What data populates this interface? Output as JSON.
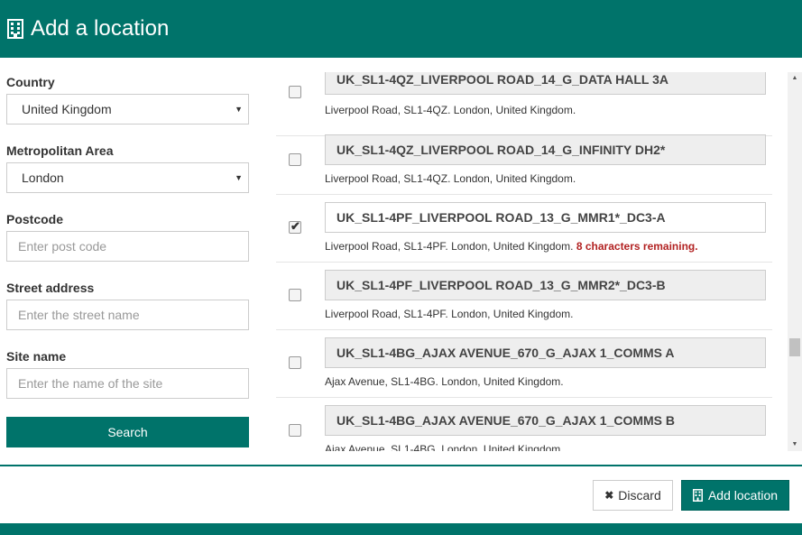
{
  "dialog": {
    "title": "Add a location",
    "title_icon": "building-icon"
  },
  "filters": {
    "country_label": "Country",
    "country_value": "United Kingdom",
    "metro_label": "Metropolitan Area",
    "metro_value": "London",
    "postcode_label": "Postcode",
    "postcode_placeholder": "Enter post code",
    "street_label": "Street address",
    "street_placeholder": "Enter the street name",
    "site_label": "Site name",
    "site_placeholder": "Enter the name of the site",
    "search_label": "Search"
  },
  "locations": [
    {
      "name": "UK_SL1-4QZ_LIVERPOOL ROAD_14_G_DATA HALL 3A",
      "address": "Liverpool Road, SL1-4QZ. London, United Kingdom.",
      "checked": false,
      "warning": ""
    },
    {
      "name": "UK_SL1-4QZ_LIVERPOOL ROAD_14_G_INFINITY DH2*",
      "address": "Liverpool Road, SL1-4QZ. London, United Kingdom.",
      "checked": false,
      "warning": ""
    },
    {
      "name": "UK_SL1-4PF_LIVERPOOL ROAD_13_G_MMR1*_DC3-A",
      "address": "Liverpool Road, SL1-4PF. London, United Kingdom.",
      "checked": true,
      "warning": "8 characters remaining."
    },
    {
      "name": "UK_SL1-4PF_LIVERPOOL ROAD_13_G_MMR2*_DC3-B",
      "address": "Liverpool Road, SL1-4PF. London, United Kingdom.",
      "checked": false,
      "warning": ""
    },
    {
      "name": "UK_SL1-4BG_AJAX AVENUE_670_G_AJAX 1_COMMS A",
      "address": "Ajax Avenue, SL1-4BG. London, United Kingdom.",
      "checked": false,
      "warning": ""
    },
    {
      "name": "UK_SL1-4BG_AJAX AVENUE_670_G_AJAX 1_COMMS B",
      "address": "Ajax Avenue, SL1-4BG. London, United Kingdom.",
      "checked": false,
      "warning": ""
    }
  ],
  "footer": {
    "discard_label": "Discard",
    "add_label": "Add location"
  },
  "colors": {
    "brand": "#00736a",
    "warning": "#b22222"
  }
}
